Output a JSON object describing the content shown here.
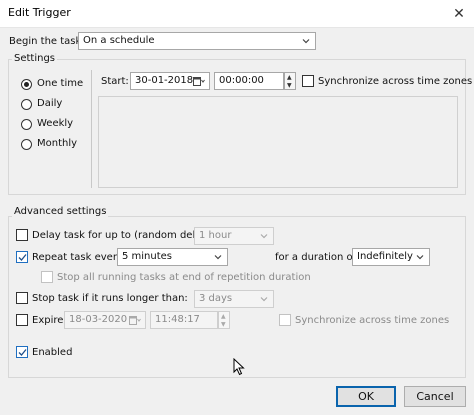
{
  "window": {
    "title": "Edit Trigger",
    "close_glyph": "✕"
  },
  "begin": {
    "label": "Begin the task:",
    "value": "On a schedule"
  },
  "settings": {
    "legend": "Settings",
    "radios": [
      {
        "label": "One time",
        "checked": true
      },
      {
        "label": "Daily",
        "checked": false
      },
      {
        "label": "Weekly",
        "checked": false
      },
      {
        "label": "Monthly",
        "checked": false
      }
    ],
    "start_label": "Start:",
    "start_date": "30-01-2018",
    "start_time": "00:00:00",
    "sync_label": "Synchronize across time zones"
  },
  "advanced": {
    "legend": "Advanced settings",
    "delay": {
      "label": "Delay task for up to (random delay):",
      "value": "1 hour",
      "checked": false
    },
    "repeat": {
      "label": "Repeat task every:",
      "value": "5 minutes",
      "checked": true,
      "duration_label": "for a duration of:",
      "duration_value": "Indefinitely"
    },
    "stop_all": {
      "label": "Stop all running tasks at end of repetition duration",
      "checked": false
    },
    "stop_long": {
      "label": "Stop task if it runs longer than:",
      "value": "3 days",
      "checked": false
    },
    "expire": {
      "label": "Expire:",
      "date": "18-03-2020",
      "time": "11:48:17",
      "checked": false,
      "sync_label": "Synchronize across time zones"
    },
    "enabled": {
      "label": "Enabled",
      "checked": true
    }
  },
  "buttons": {
    "ok": "OK",
    "cancel": "Cancel"
  }
}
